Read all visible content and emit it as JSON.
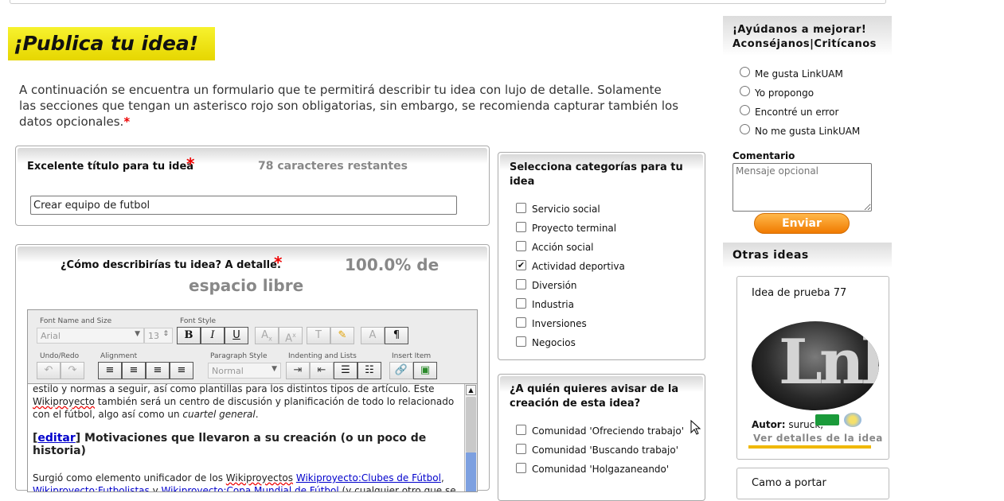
{
  "page_title": "¡Publica tu idea!",
  "intro": "A continuación se encuentra un formulario que te permitirá describir tu idea con lujo de detalle. Solamente las secciones que tengan un asterisco rojo son obligatorias, sin embargo, se recomienda capturar también los datos opcionales.",
  "asterisk": "*",
  "title_section": {
    "label": "Excelente título para tu idea",
    "remaining": "78 caracteres restantes",
    "value": "Crear equipo de futbol"
  },
  "description_section": {
    "label": "¿Cómo describirías tu idea? A detalle.",
    "space_line1": "100.0% de",
    "space_line2": "espacio libre"
  },
  "toolbar": {
    "font_group": "Font Name and Size",
    "font_name": "Arial",
    "font_size": "13",
    "style_group": "Font Style",
    "undo_group": "Undo/Redo",
    "align_group": "Alignment",
    "para_group": "Paragraph Style",
    "para_value": "Normal",
    "indent_group": "Indenting and Lists",
    "insert_group": "Insert Item"
  },
  "editor": {
    "para1_a": "estilo y normas a seguir, así como plantillas para los distintos tipos de artículo. Este ",
    "para1_b": "Wikiproyecto",
    "para1_c": " también será un centro de discusión y planificación de todo lo relacionado con el fútbol, algo así como un ",
    "para1_d": "cuartel general",
    "para1_e": ".",
    "heading_bracket_open": "[",
    "heading_edit": "editar",
    "heading_text": "] Motivaciones que llevaron a su creación (o un poco de historia)",
    "para2_a": "Surgió como elemento unificador de los ",
    "para2_b": "Wikiproyectos",
    "para2_c": " ",
    "link1": "Wikiproyecto:Clubes de Fútbol",
    "para2_d": ", ",
    "link2": "Wikiproyecto:Futbolistas",
    "para2_e": " y ",
    "link3": "Wikiproyecto:Copa Mundial de Fútbol",
    "para2_f": " (y cualquier otro que se"
  },
  "categories": {
    "title": "Selecciona categorías para tu idea",
    "items": [
      {
        "label": "Servicio social",
        "checked": false
      },
      {
        "label": "Proyecto terminal",
        "checked": false
      },
      {
        "label": "Acción social",
        "checked": false
      },
      {
        "label": "Actividad deportiva",
        "checked": true
      },
      {
        "label": "Diversión",
        "checked": false
      },
      {
        "label": "Industria",
        "checked": false
      },
      {
        "label": "Inversiones",
        "checked": false
      },
      {
        "label": "Negocios",
        "checked": false
      }
    ]
  },
  "notify": {
    "title": "¿A quién quieres avisar de la creación de esta idea?",
    "items": [
      {
        "label": "Comunidad 'Ofreciendo trabajo'",
        "checked": false
      },
      {
        "label": "Comunidad 'Buscando trabajo'",
        "checked": false
      },
      {
        "label": "Comunidad 'Holgazaneando'",
        "checked": false
      }
    ]
  },
  "feedback": {
    "title_line1": "¡Ayúdanos a mejorar!",
    "title_line2": "Aconséjanos|Critícanos",
    "options": [
      "Me gusta LinkUAM",
      "Yo propongo",
      "Encontré un error",
      "No me gusta LinkUAM"
    ],
    "comment_label": "Comentario",
    "comment_placeholder": "Mensaje opcional",
    "send_label": "Enviar"
  },
  "other_ideas": {
    "title": "Otras ideas",
    "card1_title": "Idea de prueba 77",
    "logo_text": "Lnk",
    "author_label": "Autor:",
    "author_name": "suruck,",
    "details_link": "Ver detalles de la idea",
    "card2_title": "Camo a portar"
  },
  "colors": {
    "banner": "#f7f22e",
    "required": "#e00000",
    "send_button": "#f07a00",
    "link": "#0000cc"
  }
}
